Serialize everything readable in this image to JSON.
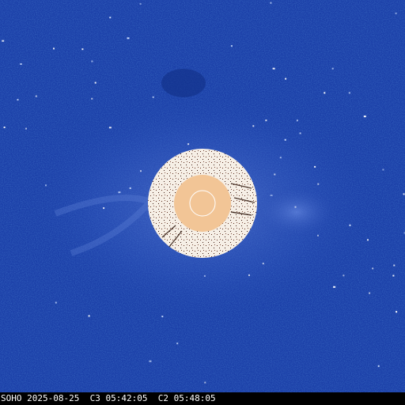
{
  "caption": {
    "observatory": "SOHO",
    "date": "2025-08-25",
    "c3_label": "C3",
    "c3_time": "05:42:05",
    "c2_label": "C2",
    "c2_time": "05:48:05"
  },
  "colors": {
    "sky": "#1b3fa8",
    "occulter_ring": "#f6efe6",
    "sun_disk": "#f2c596",
    "sun_outline": "#ffffff",
    "caption_text": "#ffffff"
  },
  "icons": [
    "sun-disk-icon"
  ]
}
